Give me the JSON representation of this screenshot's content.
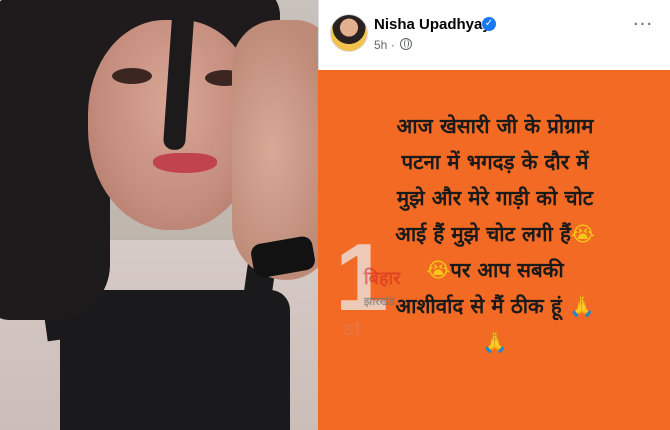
{
  "post": {
    "author": "Nisha Upadhyay",
    "verified_icon": "verified-badge-icon",
    "time": "5h",
    "separator": "·",
    "privacy_icon": "globe-icon",
    "more_icon": "more-options-icon",
    "more_symbol": "···",
    "background_color": "#f26a23",
    "lines": [
      "आज खेसारी जी के प्रोग्राम",
      "पटना में भगदड़ के दौर में",
      "मुझे और मेरे गाड़ी को चोट",
      "आई हैं  मुझे चोट लगी हैं",
      "पर आप सबकी",
      "आशीर्वाद से मैं ठीक हूं"
    ],
    "emoji_cry": "😭",
    "emoji_pray": "🙏"
  },
  "watermark": {
    "number": "1",
    "line1": "बिहार",
    "line2": "झारखंड",
    "tag": "st"
  }
}
